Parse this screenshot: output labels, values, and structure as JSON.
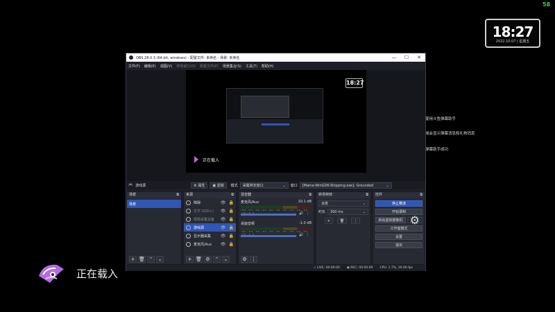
{
  "overlay": {
    "fps": "58",
    "clock_time": "18:27",
    "clock_date": "2022.10.07 | 星期五",
    "notes": [
      "欢迎使用斗鱼弹幕助手",
      "本区域会显示弹幕消息和礼物消息",
      "添加弹幕助手成功"
    ],
    "loading_text": "正在载入"
  },
  "window": {
    "title": "OBS 28.0.3 (64-bit, windows) - 配置文件: 未命名 - 场景: 未命名",
    "controls": [
      "—",
      "☐",
      "✕"
    ],
    "menu": [
      "文件(F)",
      "编辑(E)",
      "视图(V)",
      "停靠窗口(D)",
      "配置文件(P)",
      "场景集合(S)",
      "工具(T)",
      "帮助(H)"
    ]
  },
  "preview": {
    "clock": "18:27",
    "loading": "正在载入"
  },
  "toolbar": {
    "source_name": "游戏源",
    "props_label": "属性",
    "filters_label": "滤镜",
    "mode_label": "模式",
    "mode_value": "采集特定窗口",
    "window_label": "窗口",
    "window_value": "[Maine-WinGDK-Shipping.exe]: Grounded"
  },
  "docks": {
    "scenes": {
      "title": "场景",
      "items": [
        "场景"
      ]
    },
    "sources": {
      "title": "来源",
      "items": [
        "障碍",
        "文字 (GDI+)",
        "视频采集设备",
        "游戏源",
        "显示器采集",
        "麦克风/Aux"
      ]
    },
    "mixer": {
      "title": "混音器",
      "channels": [
        {
          "name": "麦克风/Aux",
          "db": "10.1 dB"
        },
        {
          "name": "桌面音频",
          "db": "-1.0 dB"
        }
      ],
      "scale": "-60 -55 -50 -45 -40 -35 -30 -25 -20 -15 -10 -5 0"
    },
    "transitions": {
      "title": "转场特效",
      "type": "淡变",
      "duration_label": "时长",
      "duration": "300 ms"
    },
    "controls": {
      "title": "控件",
      "buttons": [
        "停止推流",
        "开始录制",
        "启动虚拟摄像机",
        "工作室模式",
        "设置",
        "退出"
      ]
    }
  },
  "status": {
    "live": "LIVE: 00:00:00",
    "rec": "REC: 00:00:00",
    "cpu": "CPU: 1.7%, 30.00 fps"
  },
  "colors": {
    "accent": "#2f56b5",
    "fps_green": "#3ed43e",
    "bg": "#000000"
  }
}
